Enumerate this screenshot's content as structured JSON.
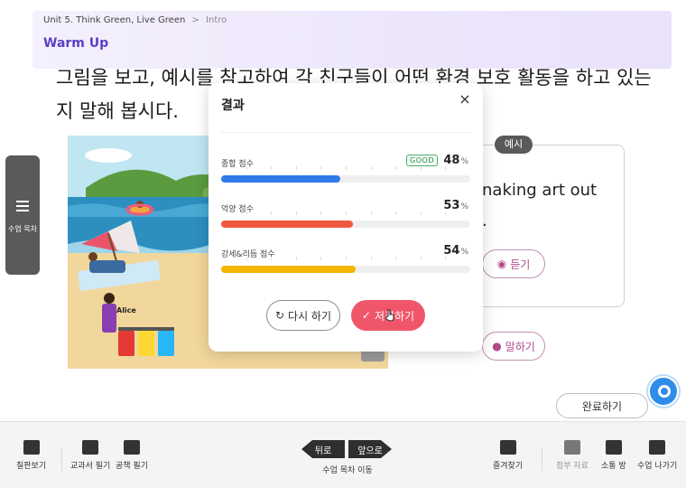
{
  "header": {
    "unit": "Unit 5. Think Green, Live Green",
    "separator": ">",
    "page": "Intro",
    "section": "Warm Up"
  },
  "instruction": "그림을 보고, 예시를 참고하여 각 친구들이 어떤 환경 보호 활동을 하고 있는지 말해 봅시다.",
  "side_tab": {
    "label": "수업 목차",
    "icon": "list-icon"
  },
  "illustration": {
    "character_label": "Alice"
  },
  "example_card": {
    "tag": "예시",
    "text_line1": "naking art out",
    "text_line2": ".",
    "listen_label": "듣기",
    "speak_label": "말하기"
  },
  "modal": {
    "title": "결과",
    "close": "×",
    "scores": [
      {
        "label": "종합 점수",
        "value": 48,
        "unit": "%",
        "badge": "GOOD",
        "color": "#2f7bea"
      },
      {
        "label": "억양 점수",
        "value": 53,
        "unit": "%",
        "badge": "",
        "color": "#f0583f"
      },
      {
        "label": "강세&리듬 점수",
        "value": 54,
        "unit": "%",
        "badge": "",
        "color": "#f5b400"
      }
    ],
    "retry_label": "다시 하기",
    "save_label": "저장하기"
  },
  "done_label": "완료하기",
  "toolbar": {
    "blackboard": "칠판보기",
    "textbook_note": "교과서 필기",
    "notebook_note": "공책 필기",
    "prev": "뒤로",
    "next": "앞으로",
    "nav_label": "수업 목차 이동",
    "bookmark": "즐겨찾기",
    "attachment": "첨부 자료",
    "chat": "소통 방",
    "exit": "수업 나가기"
  }
}
